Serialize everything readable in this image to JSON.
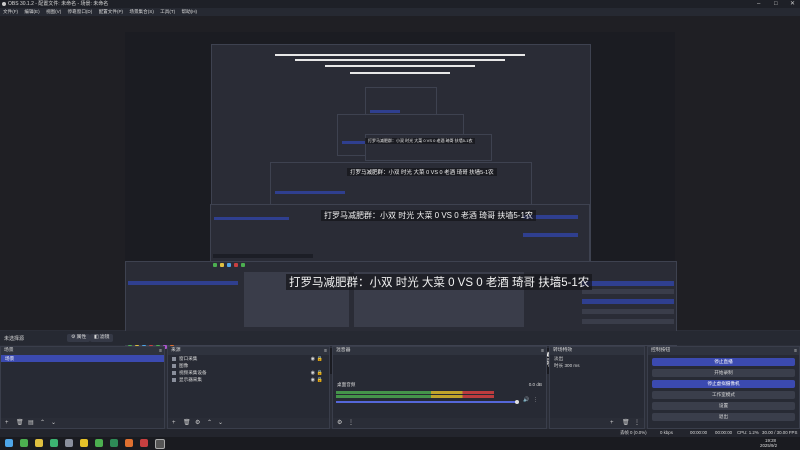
{
  "window": {
    "title": "OBS 30.1.2 - 配置文件: 未命名 - 场景: 未命名"
  },
  "menu": [
    "文件(F)",
    "编辑(E)",
    "视图(V)",
    "停靠窗口(D)",
    "配置文件(P)",
    "场景集合(S)",
    "工具(T)",
    "帮助(H)"
  ],
  "overlay_text": "打罗马减肥群：小双 时光 大菜 0 VS 0 老酒 琦哥 扶墙5-1农",
  "scene_bar": {
    "label": "未选择源",
    "properties": "属性",
    "filters": "滤镜"
  },
  "scenes": {
    "header": "场景",
    "items": [
      "场景"
    ]
  },
  "sources": {
    "header": "来源",
    "items": [
      {
        "name": "窗口采集"
      },
      {
        "name": "图像"
      },
      {
        "name": "视频采集设备"
      },
      {
        "name": "显示器采集"
      }
    ]
  },
  "mixer": {
    "header": "混音器",
    "tracks": [
      {
        "name": "桌面音频",
        "db": "0.0 dB"
      }
    ]
  },
  "transitions": {
    "header": "转场特效",
    "fade": "淡出",
    "duration_label": "时长",
    "duration": "300 ms"
  },
  "controls": {
    "header": "控制按钮",
    "buttons": [
      "停止直播",
      "开始录制",
      "停止虚拟摄像机",
      "工作室模式",
      "设置",
      "退出"
    ]
  },
  "status": {
    "dropped": "丢帧 0 (0.0%)",
    "bitrate": "0 kbps",
    "live_time": "00:00:00",
    "rec_time": "00:00:00",
    "cpu": "CPU: 1.2%",
    "fps": "30.00 / 30.00 FPS"
  },
  "taskbar": {
    "time": "19:28",
    "date": "2025/9/2"
  },
  "colors": {
    "accent": "#3b4ab0",
    "bg": "#2b2e38",
    "panel": "#272a34"
  }
}
